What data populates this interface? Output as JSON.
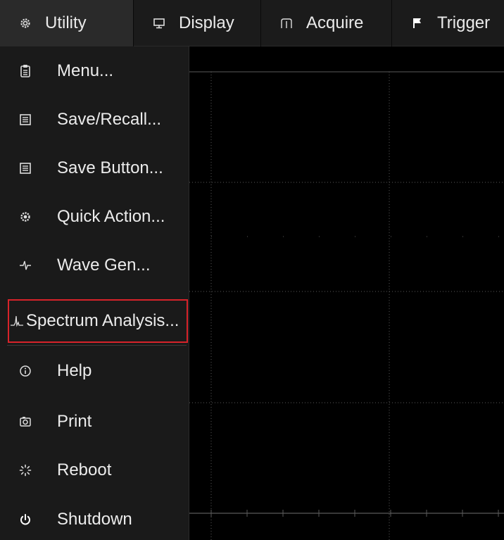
{
  "topbar": {
    "items": [
      {
        "label": "Utility",
        "icon": "gear-icon"
      },
      {
        "label": "Display",
        "icon": "monitor-icon"
      },
      {
        "label": "Acquire",
        "icon": "acquire-icon"
      },
      {
        "label": "Trigger",
        "icon": "flag-icon"
      }
    ]
  },
  "menu": {
    "items": [
      {
        "label": "Menu...",
        "icon": "clipboard-icon"
      },
      {
        "label": "Save/Recall...",
        "icon": "save-icon"
      },
      {
        "label": "Save Button...",
        "icon": "save-icon"
      },
      {
        "label": "Quick Action...",
        "icon": "gear-icon"
      },
      {
        "label": "Wave Gen...",
        "icon": "wave-icon"
      },
      {
        "label": "Spectrum Analysis...",
        "icon": "spectrum-icon"
      },
      {
        "label": "Help",
        "icon": "info-icon"
      },
      {
        "label": "Print",
        "icon": "camera-icon"
      },
      {
        "label": "Reboot",
        "icon": "spinner-icon"
      },
      {
        "label": "Shutdown",
        "icon": "power-icon"
      }
    ]
  },
  "colors": {
    "highlight_border": "#d8232a",
    "menu_bg": "#1a1a1a",
    "grid_line": "#5a5a5a"
  }
}
